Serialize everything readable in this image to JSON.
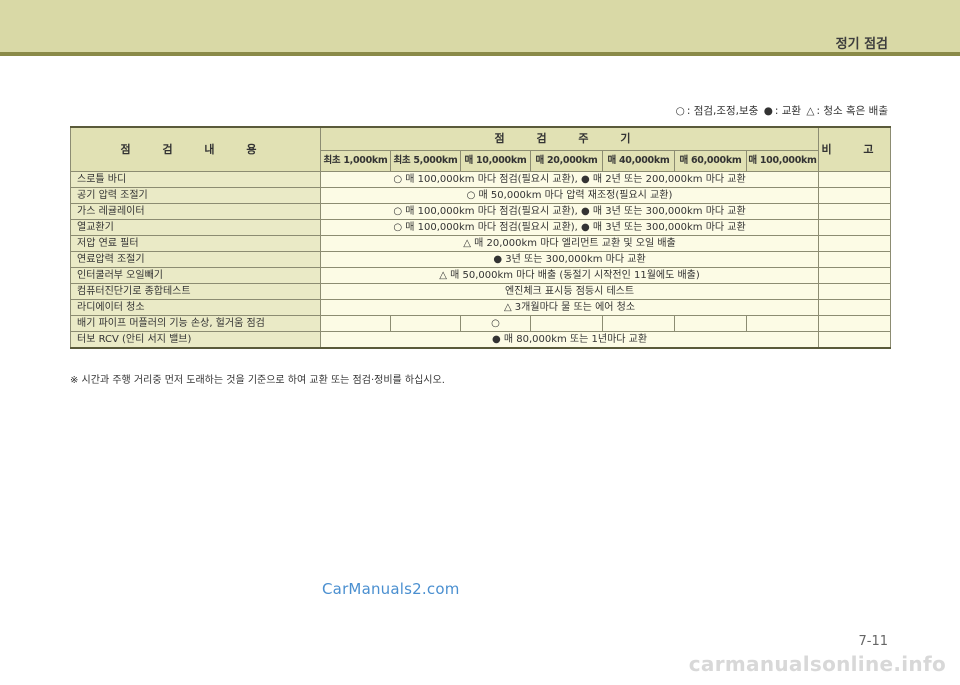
{
  "header": {
    "title": "정기 점검"
  },
  "legend": {
    "circle_symbol": "○",
    "circle_text": ": 점검,조정,보충",
    "dot_symbol": "●",
    "dot_text": ": 교환",
    "triangle_symbol": "△",
    "triangle_text": ": 청소 혹은 배출"
  },
  "table": {
    "header_item": "점 검 내 용",
    "header_period": "점 검 주 기",
    "header_remark": "비 고",
    "intervals": [
      "최초 1,000km",
      "최초 5,000km",
      "매 10,000km",
      "매 20,000km",
      "매 40,000km",
      "매 60,000km",
      "매 100,000km"
    ],
    "rows": [
      {
        "item": "스로틀 바디",
        "schedule": "○ 매 100,000km 마다 점검(필요시 교환), ● 매 2년 또는 200,000km 마다 교환"
      },
      {
        "item": "공기 압력 조절기",
        "schedule": "○ 매 50,000km 마다 압력 재조정(필요시 교환)"
      },
      {
        "item": "가스 레귤레이터",
        "schedule": "○ 매 100,000km 마다 점검(필요시 교환), ● 매 3년 또는 300,000km 마다 교환"
      },
      {
        "item": "열교환기",
        "schedule": "○ 매 100,000km 마다 점검(필요시 교환), ● 매 3년 또는 300,000km 마다 교환"
      },
      {
        "item": "저압 연료 필터",
        "schedule": "△ 매 20,000km 마다 엘리먼트 교환 및 오일 배출"
      },
      {
        "item": "연료압력 조절기",
        "schedule": "● 3년 또는 300,000km 마다 교환"
      },
      {
        "item": "인터쿨러부 오일빼기",
        "schedule": "△ 매 50,000km 마다 배출 (동절기 시작전인 11월에도 배출)"
      },
      {
        "item": "컴퓨터진단기로 종합테스트",
        "schedule": "엔진체크 표시등 점등시 테스트"
      },
      {
        "item": "라디에이터 청소",
        "schedule": "△ 3개월마다 물 또는 에어 청소"
      },
      {
        "item": "배기 파이프 머플러의 기능 손상, 헐거움 점검",
        "cells": [
          "",
          "",
          "○",
          "",
          "",
          "",
          ""
        ]
      },
      {
        "item": "터보 RCV (안티 서지 밸브)",
        "schedule": "● 매 80,000km 또는 1년마다 교환"
      }
    ]
  },
  "footnote": "※ 시간과 주행 거리중 먼저 도래하는 것을 기준으로 하여 교환 또는 점검·정비를 하십시오.",
  "watermark": "CarManuals2.com",
  "page_number": "7-11",
  "site_mark": "carmanualsonline.info"
}
